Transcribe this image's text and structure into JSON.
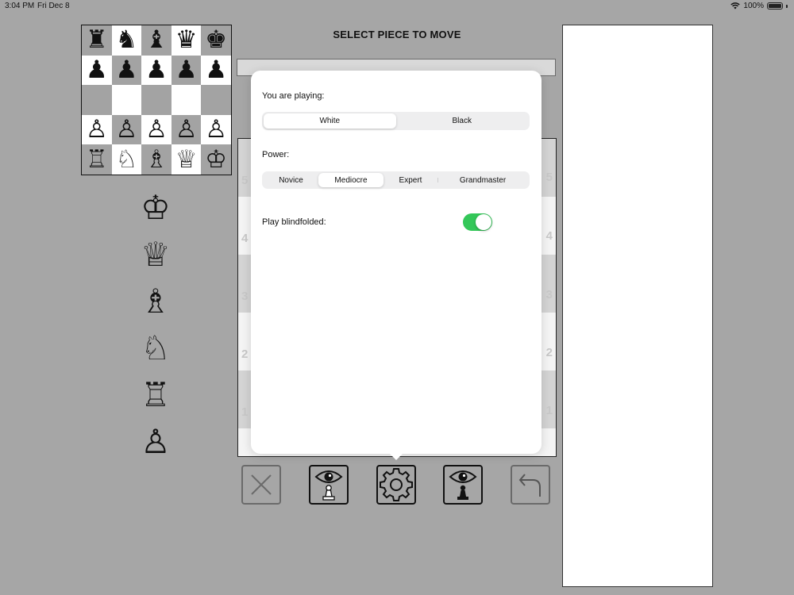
{
  "status_bar": {
    "time": "3:04 PM",
    "date": "Fri Dec 8",
    "battery": "100%"
  },
  "title": "SELECT PIECE TO MOVE",
  "mini_board": {
    "rows": [
      [
        "♜",
        "♞",
        "♝",
        "♛",
        "♚"
      ],
      [
        "♟",
        "♟",
        "♟",
        "♟",
        "♟"
      ],
      [
        "",
        "",
        "",
        "",
        ""
      ],
      [
        "♙",
        "♙",
        "♙",
        "♙",
        "♙"
      ],
      [
        "♖",
        "♘",
        "♗",
        "♕",
        "♔"
      ]
    ]
  },
  "promotion_pieces": [
    "♔",
    "♕",
    "♗",
    "♘",
    "♖",
    "♙"
  ],
  "board": {
    "rank_labels": [
      "5",
      "4",
      "3",
      "2",
      "1"
    ]
  },
  "settings": {
    "playing_label": "You are playing:",
    "color_options": [
      "White",
      "Black"
    ],
    "color_selected": "White",
    "power_label": "Power:",
    "power_options": [
      "Novice",
      "Mediocre",
      "Expert",
      "Grandmaster"
    ],
    "power_selected": "Mediocre",
    "blindfold_label": "Play blindfolded:",
    "blindfold_on": true,
    "toggle_color": "#34c759"
  },
  "toolbar": {
    "icons": [
      "close-icon",
      "eye-white-pawn-icon",
      "gear-icon",
      "eye-black-pawn-icon",
      "undo-icon"
    ]
  }
}
